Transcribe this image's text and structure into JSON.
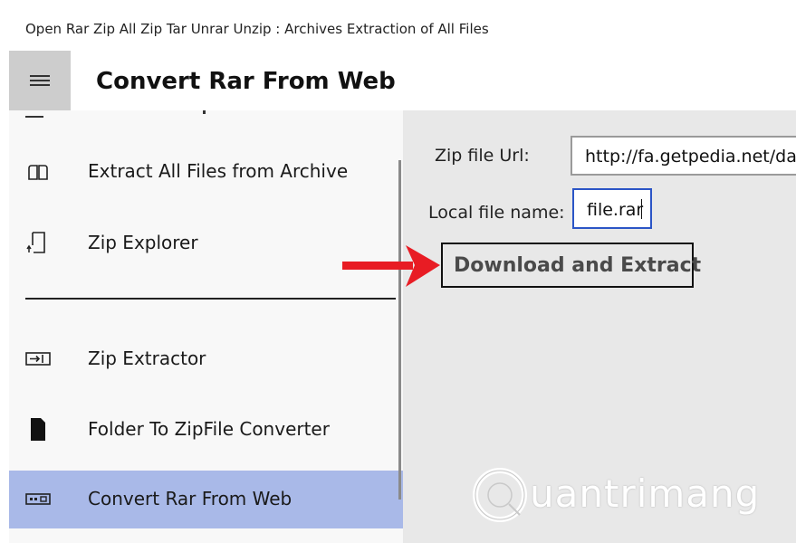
{
  "window": {
    "title": "Open Rar Zip All Zip Tar Unrar Unzip : Archives Extraction of All Files"
  },
  "header": {
    "page_title": "Convert Rar From Web"
  },
  "sidebar": {
    "items": [
      {
        "label": "Extract All Files from  Archive",
        "icon": "open-book-icon"
      },
      {
        "label": "Zip Explorer",
        "icon": "document-arrow-icon"
      },
      {
        "label": "Zip Extractor",
        "icon": "extract-box-icon"
      },
      {
        "label": "Folder To ZipFile Converter",
        "icon": "file-icon"
      },
      {
        "label": "Convert Rar From Web",
        "icon": "web-archive-icon",
        "selected": true
      }
    ]
  },
  "form": {
    "url_label": "Zip file Url:",
    "url_value": "http://fa.getpedia.net/dat",
    "name_label": "Local file name:",
    "name_value": "file.rar",
    "button_label": "Download and Extract"
  },
  "watermark": {
    "text": "uantrimang"
  },
  "colors": {
    "selected": "#a9b9e8",
    "focus": "#2b55c6",
    "arrow": "#e81c24",
    "content_bg": "#e8e8e8"
  }
}
